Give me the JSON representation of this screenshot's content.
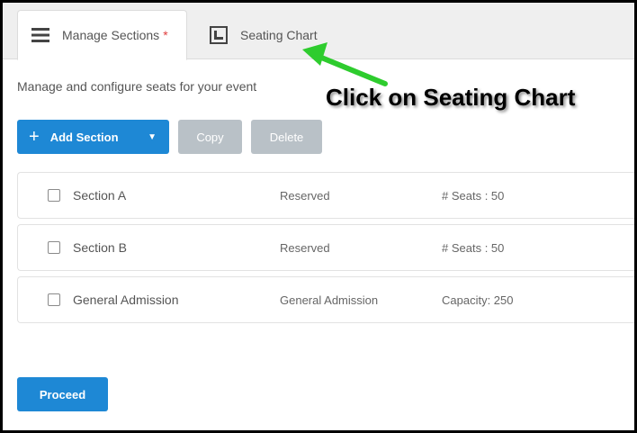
{
  "tabs": [
    {
      "label": "Manage Sections",
      "required_mark": "*",
      "icon": "menu-icon",
      "active": true
    },
    {
      "label": "Seating Chart",
      "icon": "chart-icon",
      "active": false
    }
  ],
  "annotation": {
    "text": "Click on Seating Chart",
    "arrow_color": "#2ecc2e"
  },
  "subtitle": "Manage and configure seats for your event",
  "toolbar": {
    "add_label": "Add Section",
    "copy_label": "Copy",
    "delete_label": "Delete"
  },
  "sections": [
    {
      "name": "Section A",
      "type": "Reserved",
      "capacity": "# Seats : 50"
    },
    {
      "name": "Section B",
      "type": "Reserved",
      "capacity": "# Seats : 50"
    },
    {
      "name": "General Admission",
      "type": "General Admission",
      "capacity": "Capacity: 250"
    }
  ],
  "proceed_label": "Proceed",
  "colors": {
    "primary": "#1e88d5",
    "disabled": "#b9c1c7",
    "required": "#e04040"
  }
}
